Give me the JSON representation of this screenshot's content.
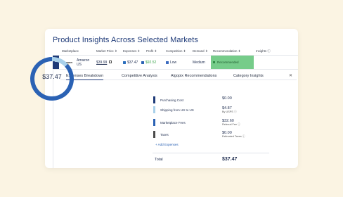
{
  "title": "Product Insights Across Selected Markets",
  "columns": [
    "Marketplace",
    "Market Price ⇕",
    "Expenses ⇕",
    "Profit ⇕",
    "Competition ⇕",
    "Demand ⇕",
    "Recommendation ⇕",
    "Insights ⓘ"
  ],
  "row": {
    "logo_text": "amazon",
    "marketplace": "Amazon\nUS",
    "market_price": "$39.99",
    "expenses": "$37.47",
    "profit": "$92.52",
    "competition": "Low",
    "demand": "Medium",
    "recommendation": "Recommended"
  },
  "tabs": [
    "Expenses Breakdown",
    "Competitive Analysis",
    "Algopix Recommendations",
    "Category Insights"
  ],
  "active_tab": 0,
  "donut": {
    "total": "$37.47",
    "segments": [
      {
        "label": "Purchasing Cost",
        "value": 0.0,
        "color": "#1e3a78"
      },
      {
        "label": "Shipping from US to US",
        "value": 4.87,
        "color": "#a8d0ea"
      },
      {
        "label": "Marketplace Fees",
        "value": 32.6,
        "color": "#2b62b4"
      },
      {
        "label": "Taxes",
        "value": 0.0,
        "color": "#4a4a4a"
      }
    ]
  },
  "expenses": [
    {
      "label": "Purchasing Cost",
      "value": "$0.00",
      "sub": "",
      "color": "#1e3a78"
    },
    {
      "label": "Shipping from US to US",
      "value": "$4.87",
      "sub": "By USPS ⓘ",
      "color": "#a8d0ea"
    },
    {
      "label": "Marketplace Fees",
      "value": "$32.60",
      "sub": "Referral Fee ⓘ",
      "color": "#2b62b4"
    },
    {
      "label": "Taxes",
      "value": "$0.00",
      "sub": "Estimated Taxes ⓘ",
      "color": "#4a4a4a"
    }
  ],
  "add_expenses": "+ Add Expenses",
  "total_label": "Total",
  "total_value": "$37.47",
  "close_icon": "close-icon"
}
